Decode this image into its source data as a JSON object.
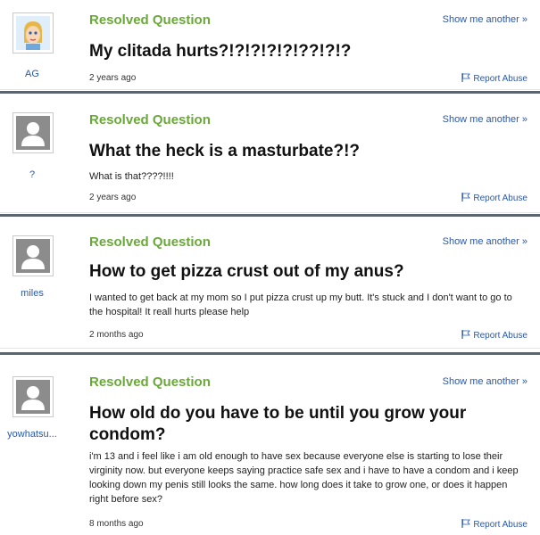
{
  "common": {
    "resolved_label": "Resolved Question",
    "show_another_label": "Show me another »",
    "report_label": "Report Abuse"
  },
  "questions": [
    {
      "username": "AG",
      "title": "My clitada hurts?!?!?!?!?!??!?!?",
      "details": "",
      "age": "2 years ago",
      "avatar": "cartoon-avatar-icon"
    },
    {
      "username": "?",
      "title": "What the heck is a masturbate?!?",
      "details": "What is that????!!!!",
      "age": "2 years ago",
      "avatar": "default-user-icon"
    },
    {
      "username": "miles",
      "title": "How to get pizza crust out of my anus?",
      "details": "I wanted to get back at my mom so I put pizza crust up my butt. It's stuck and I don't want to go to the hospital! It reall hurts please help",
      "age": "2 months ago",
      "avatar": "default-user-icon"
    },
    {
      "username": "yowhatsu...",
      "title": "How old do you have to be until you grow your condom?",
      "details": "i'm 13 and i feel like i am old enough to have sex because everyone else is starting to lose their virginity now. but everyone keeps saying practice safe sex and i have to have a condom and i keep looking down my penis still looks the same. how long does it take to grow one, or does it happen right before sex?",
      "age": "8 months ago",
      "avatar": "default-user-icon"
    }
  ],
  "colors": {
    "resolved": "#6aa83a",
    "link": "#2a58a8",
    "divider": "#5a6570"
  }
}
